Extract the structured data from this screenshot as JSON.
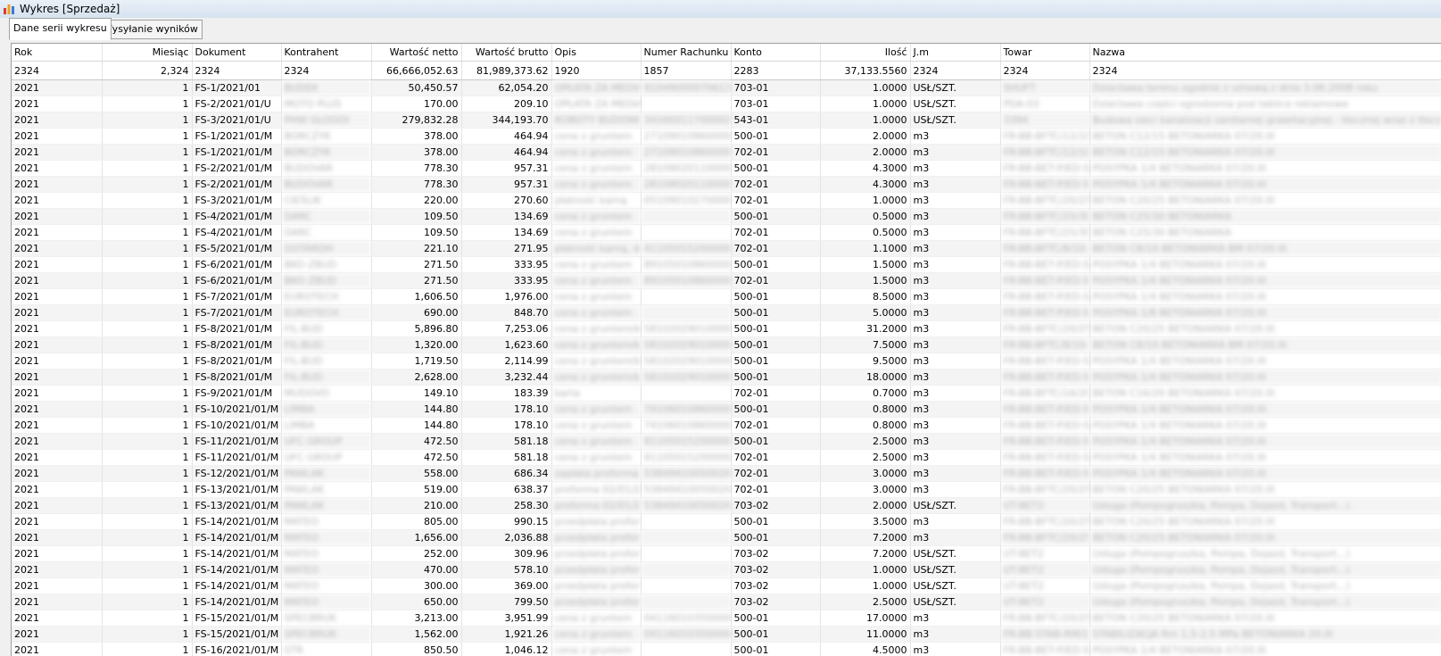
{
  "window": {
    "title": "Wykres [Sprzedaż]"
  },
  "tabs": [
    "Dane serii wykresu",
    "Wysyłanie wyników"
  ],
  "columns": [
    "Rok",
    "Miesiąc",
    "Dokument",
    "Kontrahent",
    "Wartość netto",
    "Wartość brutto",
    "Opis",
    "Numer  Rachunku",
    "Konto",
    "Ilość",
    "J.m",
    "Towar",
    "Nazwa"
  ],
  "summary": [
    "2324",
    "2,324",
    "2324",
    "2324",
    "66,666,052.63",
    "81,989,373.62",
    "1920",
    "1857",
    "2283",
    "37,133.5560",
    "2324",
    "2324",
    "2324"
  ],
  "rows": [
    [
      "2021",
      "1",
      "FS-1/2021/01",
      "BUDEK",
      "50,450.57",
      "62,054.20",
      "OPŁATA ZA MEDIAC",
      "91049000070613860",
      "703-01",
      "1.0000",
      "USŁ/SZT.",
      "SHUFT",
      "Dzierżawa terenu zgodnie z umową z dnia 3.06.2008 roku"
    ],
    [
      "2021",
      "1",
      "FS-2/2021/01/U",
      "MOTO PLUS",
      "170.00",
      "209.10",
      "OPŁATA ZA MEDIA",
      "",
      "703-01",
      "1.0000",
      "USŁ/SZT.",
      "PDA-03",
      "Dzierżawa części ogrodzenia pod tablice reklamowe"
    ],
    [
      "2021",
      "1",
      "FS-3/2021/01/U",
      "PHW GLOGOI",
      "279,832.28",
      "344,193.70",
      "ROBOTY BUDOWLAN",
      "34160011700002216",
      "543-01",
      "1.0000",
      "USŁ/SZT.",
      "3394",
      "Budowa sieci kanalizacji sanitarnej grawitacyjnej - tłocznej wraz z tłocznią ścieków"
    ],
    [
      "2021",
      "1",
      "FS-1/2021/01/M",
      "BORCZYK",
      "378.00",
      "464.94",
      "cena z gruntem",
      "27109010860000000",
      "500-01",
      "2.0000",
      "m3",
      "FR-BB-BFTC/12/10-S",
      "BETON C12/15 BETONIARKA 07/20.III"
    ],
    [
      "2021",
      "1",
      "FS-1/2021/01/M",
      "BORCZYK",
      "378.00",
      "464.94",
      "cena z gruntem",
      "27109010860000000",
      "702-01",
      "2.0000",
      "m3",
      "FR-BB-BFTC/12/10-S",
      "BETON C12/15 BETONIARKA 07/20.III"
    ],
    [
      "2021",
      "1",
      "FS-2/2021/01/M",
      "BUDOVAR",
      "778.30",
      "957.31",
      "cena z gruntem",
      "28109020110000000",
      "500-01",
      "4.3000",
      "m3",
      "FR-BB-BET-P/ED-S",
      "POSYPKA 1/4 BETONIARKA 07/20.III"
    ],
    [
      "2021",
      "1",
      "FS-2/2021/01/M",
      "BUDOVAR",
      "778.30",
      "957.31",
      "cena z gruntem",
      "28109020110000000",
      "702-01",
      "4.3000",
      "m3",
      "FR-BB-BET-P/ED-S",
      "POSYPKA 1/4 BETONIARKA 07/20.III"
    ],
    [
      "2021",
      "1",
      "FS-3/2021/01/M",
      "CIEŚLIK",
      "220.00",
      "270.60",
      "płatność karną",
      "05109010270000000",
      "702-01",
      "1.0000",
      "m3",
      "FR-BB-BFTC/20/25-S",
      "BETON C20/25 BETONIARKA 07/20.III"
    ],
    [
      "2021",
      "1",
      "FS-4/2021/01/M",
      "DARC",
      "109.50",
      "134.69",
      "cena z gruntem",
      "",
      "500-01",
      "0.5000",
      "m3",
      "FR-BB-BFTC/25/30",
      "BETON C25/30 BETONIARKA"
    ],
    [
      "2021",
      "1",
      "FS-4/2021/01/M",
      "DARC",
      "109.50",
      "134.69",
      "cena z gruntem",
      "",
      "702-01",
      "0.5000",
      "m3",
      "FR-BB-BFTC/25/30",
      "BETON C25/30 BETONIARKA"
    ],
    [
      "2021",
      "1",
      "FS-5/2021/01/M",
      "GOTARDH",
      "221.10",
      "271.95",
      "płatność karną, dodat",
      "41105015200000000",
      "702-01",
      "1.1000",
      "m3",
      "FR-BB-BFTC/8/10-BM",
      "BETON C8/10 BETONIARKA BM 07/20.III"
    ],
    [
      "2021",
      "1",
      "FS-6/2021/01/M",
      "BKO-ZBUD",
      "271.50",
      "333.95",
      "cena z gruntem",
      "89105010860000000",
      "500-01",
      "1.5000",
      "m3",
      "FR-BB-BET-P/ED-S",
      "POSYPKA 1/4 BETONIARKA 07/20.III"
    ],
    [
      "2021",
      "1",
      "FS-6/2021/01/M",
      "BKO-ZBUD",
      "271.50",
      "333.95",
      "cena z gruntem",
      "89105010860000000",
      "702-01",
      "1.5000",
      "m3",
      "FR-BB-BET-P/ED-S",
      "POSYPKA 1/4 BETONIARKA 07/20.III"
    ],
    [
      "2021",
      "1",
      "FS-7/2021/01/M",
      "EUROTECH",
      "1,606.50",
      "1,976.00",
      "cena z gruntem",
      "",
      "500-01",
      "8.5000",
      "m3",
      "FR-BB-BET-P/ED-S",
      "POSYPKA 1/4 BETONIARKA 07/20.III"
    ],
    [
      "2021",
      "1",
      "FS-7/2021/01/M",
      "EUROTECH",
      "690.00",
      "848.70",
      "cena z gruntem",
      "",
      "500-01",
      "5.0000",
      "m3",
      "FR-BB-BET-P/ED-S",
      "POSYPKA 1/8 BETONIARKA 07/20.III"
    ],
    [
      "2021",
      "1",
      "FS-8/2021/01/M",
      "FIL-BUD",
      "5,896.80",
      "7,253.06",
      "cena z gruntem/kru",
      "58102029010000000",
      "500-01",
      "31.2000",
      "m3",
      "FR-BB-BFTC/20/25-S",
      "BETON C20/25 BETONIARKA 07/20.III"
    ],
    [
      "2021",
      "1",
      "FS-8/2021/01/M",
      "FIL-BUD",
      "1,320.00",
      "1,623.60",
      "cena z gruntem/kru",
      "58102029010000000",
      "500-01",
      "7.5000",
      "m3",
      "FR-BB-BFTC/8/10-BM",
      "BETON C8/10 BETONIARKA BM 07/20.III"
    ],
    [
      "2021",
      "1",
      "FS-8/2021/01/M",
      "FIL-BUD",
      "1,719.50",
      "2,114.99",
      "cena z gruntem/kru",
      "58102029010000000",
      "500-01",
      "9.5000",
      "m3",
      "FR-BB-BET-P/ED-S",
      "POSYPKA 1/4 BETONIARKA 07/20.III"
    ],
    [
      "2021",
      "1",
      "FS-8/2021/01/M",
      "FIL-BUD",
      "2,628.00",
      "3,232.44",
      "cena z gruntem/kru",
      "58102029010000000",
      "500-01",
      "18.0000",
      "m3",
      "FR-BB-BET-P/ED-S",
      "POSYPKA 1/4 BETONIARKA 07/20.III"
    ],
    [
      "2021",
      "1",
      "FS-9/2021/01/M",
      "MUDOVO",
      "149.10",
      "183.39",
      "karta",
      "",
      "702-01",
      "0.7000",
      "m3",
      "FR-BB-BFTC/16/20-S",
      "BETON C16/20 BETONIARKA 07/20.III"
    ],
    [
      "2021",
      "1",
      "FS-10/2021/01/M",
      "LIMBA",
      "144.80",
      "178.10",
      "cena z gruntem",
      "74106010860000000",
      "500-01",
      "0.8000",
      "m3",
      "FR-BB-BET-P/ED-S",
      "POSYPKA 1/4 BETONIARKA 07/20.III"
    ],
    [
      "2021",
      "1",
      "FS-10/2021/01/M",
      "LIMBA",
      "144.80",
      "178.10",
      "cena z gruntem",
      "74106010860000000",
      "702-01",
      "0.8000",
      "m3",
      "FR-BB-BET-P/ED-S",
      "POSYPKA 1/4 BETONIARKA 07/20.III"
    ],
    [
      "2021",
      "1",
      "FS-11/2021/01/M",
      "UFC GROUP",
      "472.50",
      "581.18",
      "cena z gruntem",
      "91105015200000000",
      "500-01",
      "2.5000",
      "m3",
      "FR-BB-BET-P/ED-S",
      "POSYPKA 1/4 BETONIARKA 07/20.III"
    ],
    [
      "2021",
      "1",
      "FS-11/2021/01/M",
      "UFC GROUP",
      "472.50",
      "581.18",
      "cena z gruntem",
      "91105015200000000",
      "702-01",
      "2.5000",
      "m3",
      "FR-BB-BET-P/ED-S",
      "POSYPKA 1/4 BETONIARKA 07/20.III"
    ],
    [
      "2021",
      "1",
      "FS-12/2021/01/M",
      "PAWLAK",
      "558.00",
      "686.34",
      "zapłata proforma , p",
      "53849410050020000",
      "702-01",
      "3.0000",
      "m3",
      "FR-BB-BET-P/ED-S",
      "POSYPKA 1/4 BETONIARKA 07/20.III"
    ],
    [
      "2021",
      "1",
      "FS-13/2021/01/M",
      "PAWLAK",
      "519.00",
      "638.37",
      "proforma 02/01/2021",
      "53849410050020000",
      "702-01",
      "3.0000",
      "m3",
      "FR-BB-BFTC/20/25-S",
      "BETON C20/25 BETONIARKA 07/20.III"
    ],
    [
      "2021",
      "1",
      "FS-13/2021/01/M",
      "PAWLAK",
      "210.00",
      "258.30",
      "proforma 02/01/2021",
      "53849410050020000",
      "703-02",
      "2.0000",
      "USŁ/SZT.",
      "UT-BET2",
      "Usługa (Pompogruszka, Pompa, Dojazd, Transport...)"
    ],
    [
      "2021",
      "1",
      "FS-14/2021/01/M",
      "MATEO",
      "805.00",
      "990.15",
      "przedpłata proforma",
      "",
      "500-01",
      "3.5000",
      "m3",
      "FR-BB-BFTC/20/25-S",
      "BETON C20/25 BETONIARKA 07/20.III"
    ],
    [
      "2021",
      "1",
      "FS-14/2021/01/M",
      "MATEO",
      "1,656.00",
      "2,036.88",
      "przedpłata proforma",
      "",
      "500-01",
      "7.2000",
      "m3",
      "FR-BB-BFTC/20/25-S",
      "BETON C20/25 BETONIARKA 07/20.III"
    ],
    [
      "2021",
      "1",
      "FS-14/2021/01/M",
      "MATEO",
      "252.00",
      "309.96",
      "przedpłata proforma",
      "",
      "703-02",
      "7.2000",
      "USŁ/SZT.",
      "UT-BET2",
      "Usługa (Pompogruszka, Pompa, Dojazd, Transport...)"
    ],
    [
      "2021",
      "1",
      "FS-14/2021/01/M",
      "MATEO",
      "470.00",
      "578.10",
      "przedpłata proforma",
      "",
      "703-02",
      "1.0000",
      "USŁ/SZT.",
      "UT-BET2",
      "Usługa (Pompogruszka, Pompa, Dojazd, Transport...)"
    ],
    [
      "2021",
      "1",
      "FS-14/2021/01/M",
      "MATEO",
      "300.00",
      "369.00",
      "przedpłata proforma",
      "",
      "703-02",
      "1.0000",
      "USŁ/SZT.",
      "UT-BET2",
      "Usługa (Pompogruszka, Pompa, Dojazd, Transport...)"
    ],
    [
      "2021",
      "1",
      "FS-14/2021/01/M",
      "MATEO",
      "650.00",
      "799.50",
      "przedpłata proforma",
      "",
      "703-02",
      "2.5000",
      "USŁ/SZT.",
      "UT-BET2",
      "Usługa (Pompogruszka, Pompa, Dojazd, Transport...)"
    ],
    [
      "2021",
      "1",
      "FS-15/2021/01/M",
      "SPECBRUK",
      "3,213.00",
      "3,951.99",
      "cena z gruntem",
      "04116010350000000",
      "500-01",
      "17.0000",
      "m3",
      "FR-BB-BFTC/20/25-S",
      "BETON C20/25 BETONIARKA 07/20.III"
    ],
    [
      "2021",
      "1",
      "FS-15/2021/01/M",
      "SPECBRUK",
      "1,562.00",
      "1,921.26",
      "cena z gruntem",
      "04116010350000000",
      "500-01",
      "11.0000",
      "m3",
      "FR-BB-STAB-RM/1,5",
      "STABILIZACJA Rm 1,5-2,5 MPa BETONIARKA 20.III"
    ],
    [
      "2021",
      "1",
      "FS-16/2021/01/M",
      "STR",
      "850.50",
      "1,046.12",
      "cena z gruntem",
      "",
      "500-01",
      "4.5000",
      "m3",
      "FR-BB-BET-P/ED-S",
      "POSYPKA 1/4 BETONIARKA 07/20.III"
    ]
  ]
}
